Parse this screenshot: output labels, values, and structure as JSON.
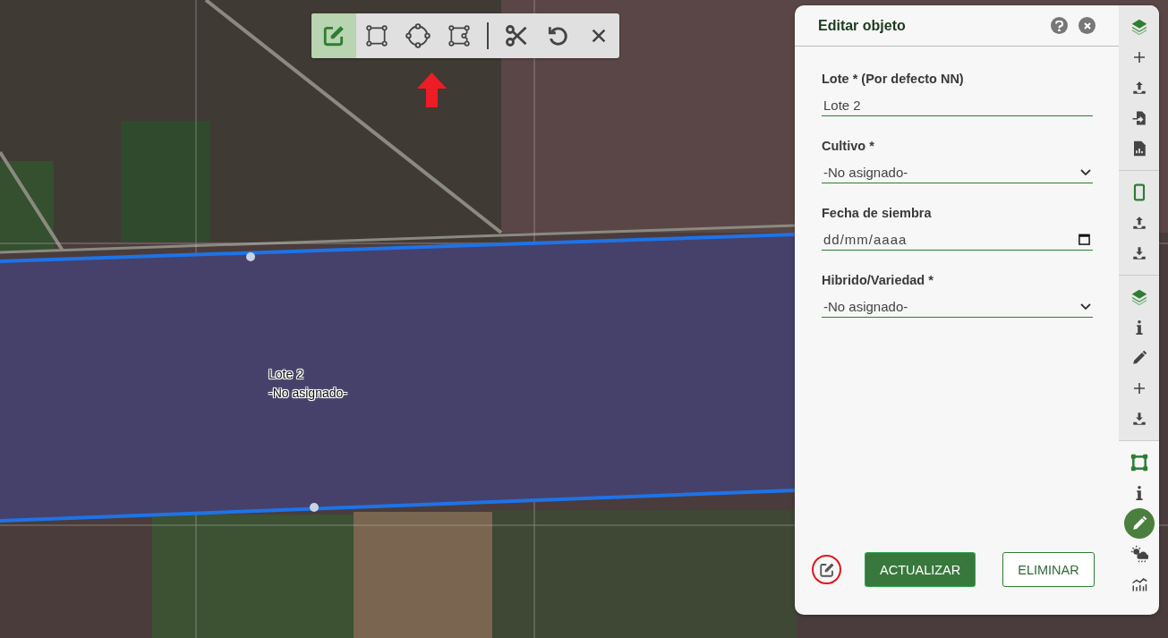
{
  "toolbar": {
    "draw_tools": [
      {
        "kind": "edit",
        "selected": true
      },
      {
        "kind": "rectangle",
        "selected": false
      },
      {
        "kind": "circle",
        "selected": false
      },
      {
        "kind": "polygon",
        "selected": false
      }
    ],
    "edit_tools": [
      {
        "kind": "cut",
        "selected": false
      },
      {
        "kind": "undo",
        "selected": false
      },
      {
        "kind": "close",
        "selected": false
      }
    ]
  },
  "map": {
    "field_label": {
      "name": "Lote 2",
      "crop": "-No asignado-"
    }
  },
  "panel": {
    "title": "Editar objeto",
    "fields": [
      {
        "kind": "text",
        "label": "Lote * (Por defecto NN)",
        "value": "Lote 2"
      },
      {
        "kind": "select",
        "label": "Cultivo *",
        "value": "-No asignado-"
      },
      {
        "kind": "date",
        "label": "Fecha de siembra",
        "placeholder": "dd/mm/aaaa"
      },
      {
        "kind": "select",
        "label": "Hibrido/Variedad *",
        "value": "-No asignado-"
      }
    ],
    "buttons": [
      {
        "kind": "primary",
        "label": "ACTUALIZAR"
      },
      {
        "kind": "secondary",
        "label": "ELIMINAR"
      }
    ]
  },
  "sidebar": {
    "groups": [
      {
        "shaded": true,
        "items": [
          {
            "kind": "layers",
            "selected": false
          },
          {
            "kind": "plus",
            "selected": false
          },
          {
            "kind": "upload",
            "selected": false
          },
          {
            "kind": "import",
            "selected": false
          },
          {
            "kind": "report",
            "selected": false
          }
        ]
      },
      {
        "shaded": true,
        "items": [
          {
            "kind": "phone",
            "selected": false
          },
          {
            "kind": "upload",
            "selected": false
          },
          {
            "kind": "download",
            "selected": false
          }
        ]
      },
      {
        "shaded": true,
        "items": [
          {
            "kind": "layers",
            "selected": false
          },
          {
            "kind": "info",
            "selected": false
          },
          {
            "kind": "pencil",
            "selected": false
          },
          {
            "kind": "plus",
            "selected": false
          },
          {
            "kind": "download",
            "selected": false
          }
        ]
      },
      {
        "shaded": false,
        "items": [
          {
            "kind": "shape",
            "selected": false
          },
          {
            "kind": "info",
            "selected": false
          },
          {
            "kind": "pencil",
            "selected": true
          },
          {
            "kind": "weather",
            "selected": false
          },
          {
            "kind": "chart",
            "selected": false
          }
        ]
      }
    ]
  }
}
